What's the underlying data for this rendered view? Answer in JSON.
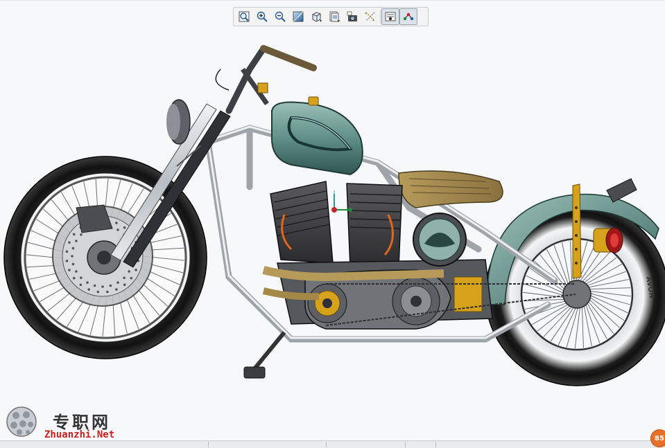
{
  "toolbar": {
    "buttons": [
      {
        "icon": "zoom-fit-icon",
        "active": false
      },
      {
        "icon": "zoom-in-icon",
        "active": false
      },
      {
        "icon": "zoom-out-icon",
        "active": false
      },
      {
        "icon": "shading-icon",
        "active": false
      },
      {
        "icon": "view-orientation-cube-icon",
        "active": false
      },
      {
        "icon": "saved-views-icon",
        "active": false
      },
      {
        "icon": "camera-icon",
        "active": false
      },
      {
        "icon": "datum-display-icon",
        "active": false
      },
      {
        "icon": "spin-center-icon",
        "active": true
      },
      {
        "icon": "annotation-display-icon",
        "active": true
      }
    ]
  },
  "model": {
    "subject": "motorcycle-3d-model",
    "tank_color": "#5f8f86",
    "accent_color": "#d6a21c",
    "tire_wall_text": "AVON"
  },
  "watermark": {
    "name_cn": "专职网",
    "url": "Zhuanzhi.Net"
  },
  "status": {
    "zoom_badge": "85"
  }
}
